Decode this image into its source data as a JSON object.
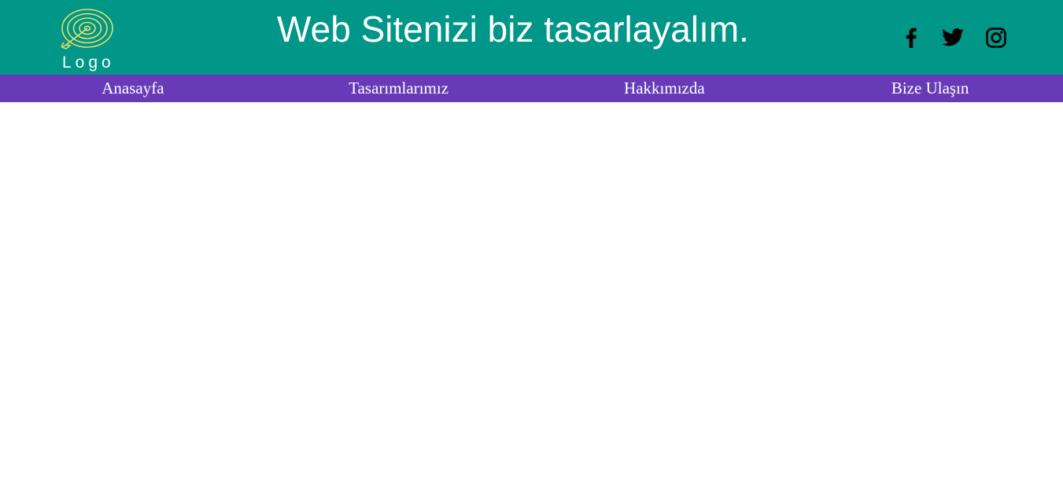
{
  "header": {
    "title": "Web Sitenizi biz tasarlayalım.",
    "background_color": "#009688",
    "logo": {
      "text": "Logo",
      "icon": "target-arrow-icon",
      "color": "#e6e064"
    },
    "social": [
      {
        "name": "Facebook",
        "icon": "facebook-icon"
      },
      {
        "name": "Twitter",
        "icon": "twitter-icon"
      },
      {
        "name": "Instagram",
        "icon": "instagram-icon"
      }
    ]
  },
  "nav": {
    "background_color": "#673ab7",
    "items": [
      {
        "label": "Anasayfa"
      },
      {
        "label": "Tasarımlarımız"
      },
      {
        "label": "Hakkımızda"
      },
      {
        "label": "Bize Ulaşın"
      }
    ]
  }
}
